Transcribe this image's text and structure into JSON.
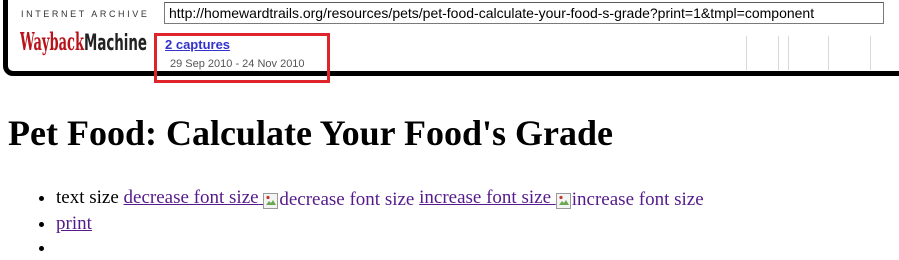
{
  "wayback": {
    "ia_label": "INTERNET ARCHIVE",
    "logo_text": "WaybackMachine",
    "url": "http://homewardtrails.org/resources/pets/pet-food-calculate-your-food-s-grade?print=1&tmpl=component",
    "captures_link": "2 captures",
    "date_range": "29 Sep 2010 - 24 Nov 2010",
    "highlight_color": "#e0242b"
  },
  "page": {
    "title": "Pet Food: Calculate Your Food's Grade",
    "tools": {
      "text_size_label": "text size",
      "decrease_link": "decrease font size",
      "decrease_img_alt": "decrease font size",
      "increase_link": "increase font size",
      "increase_img_alt": "increase font size",
      "print_link": "print"
    }
  }
}
